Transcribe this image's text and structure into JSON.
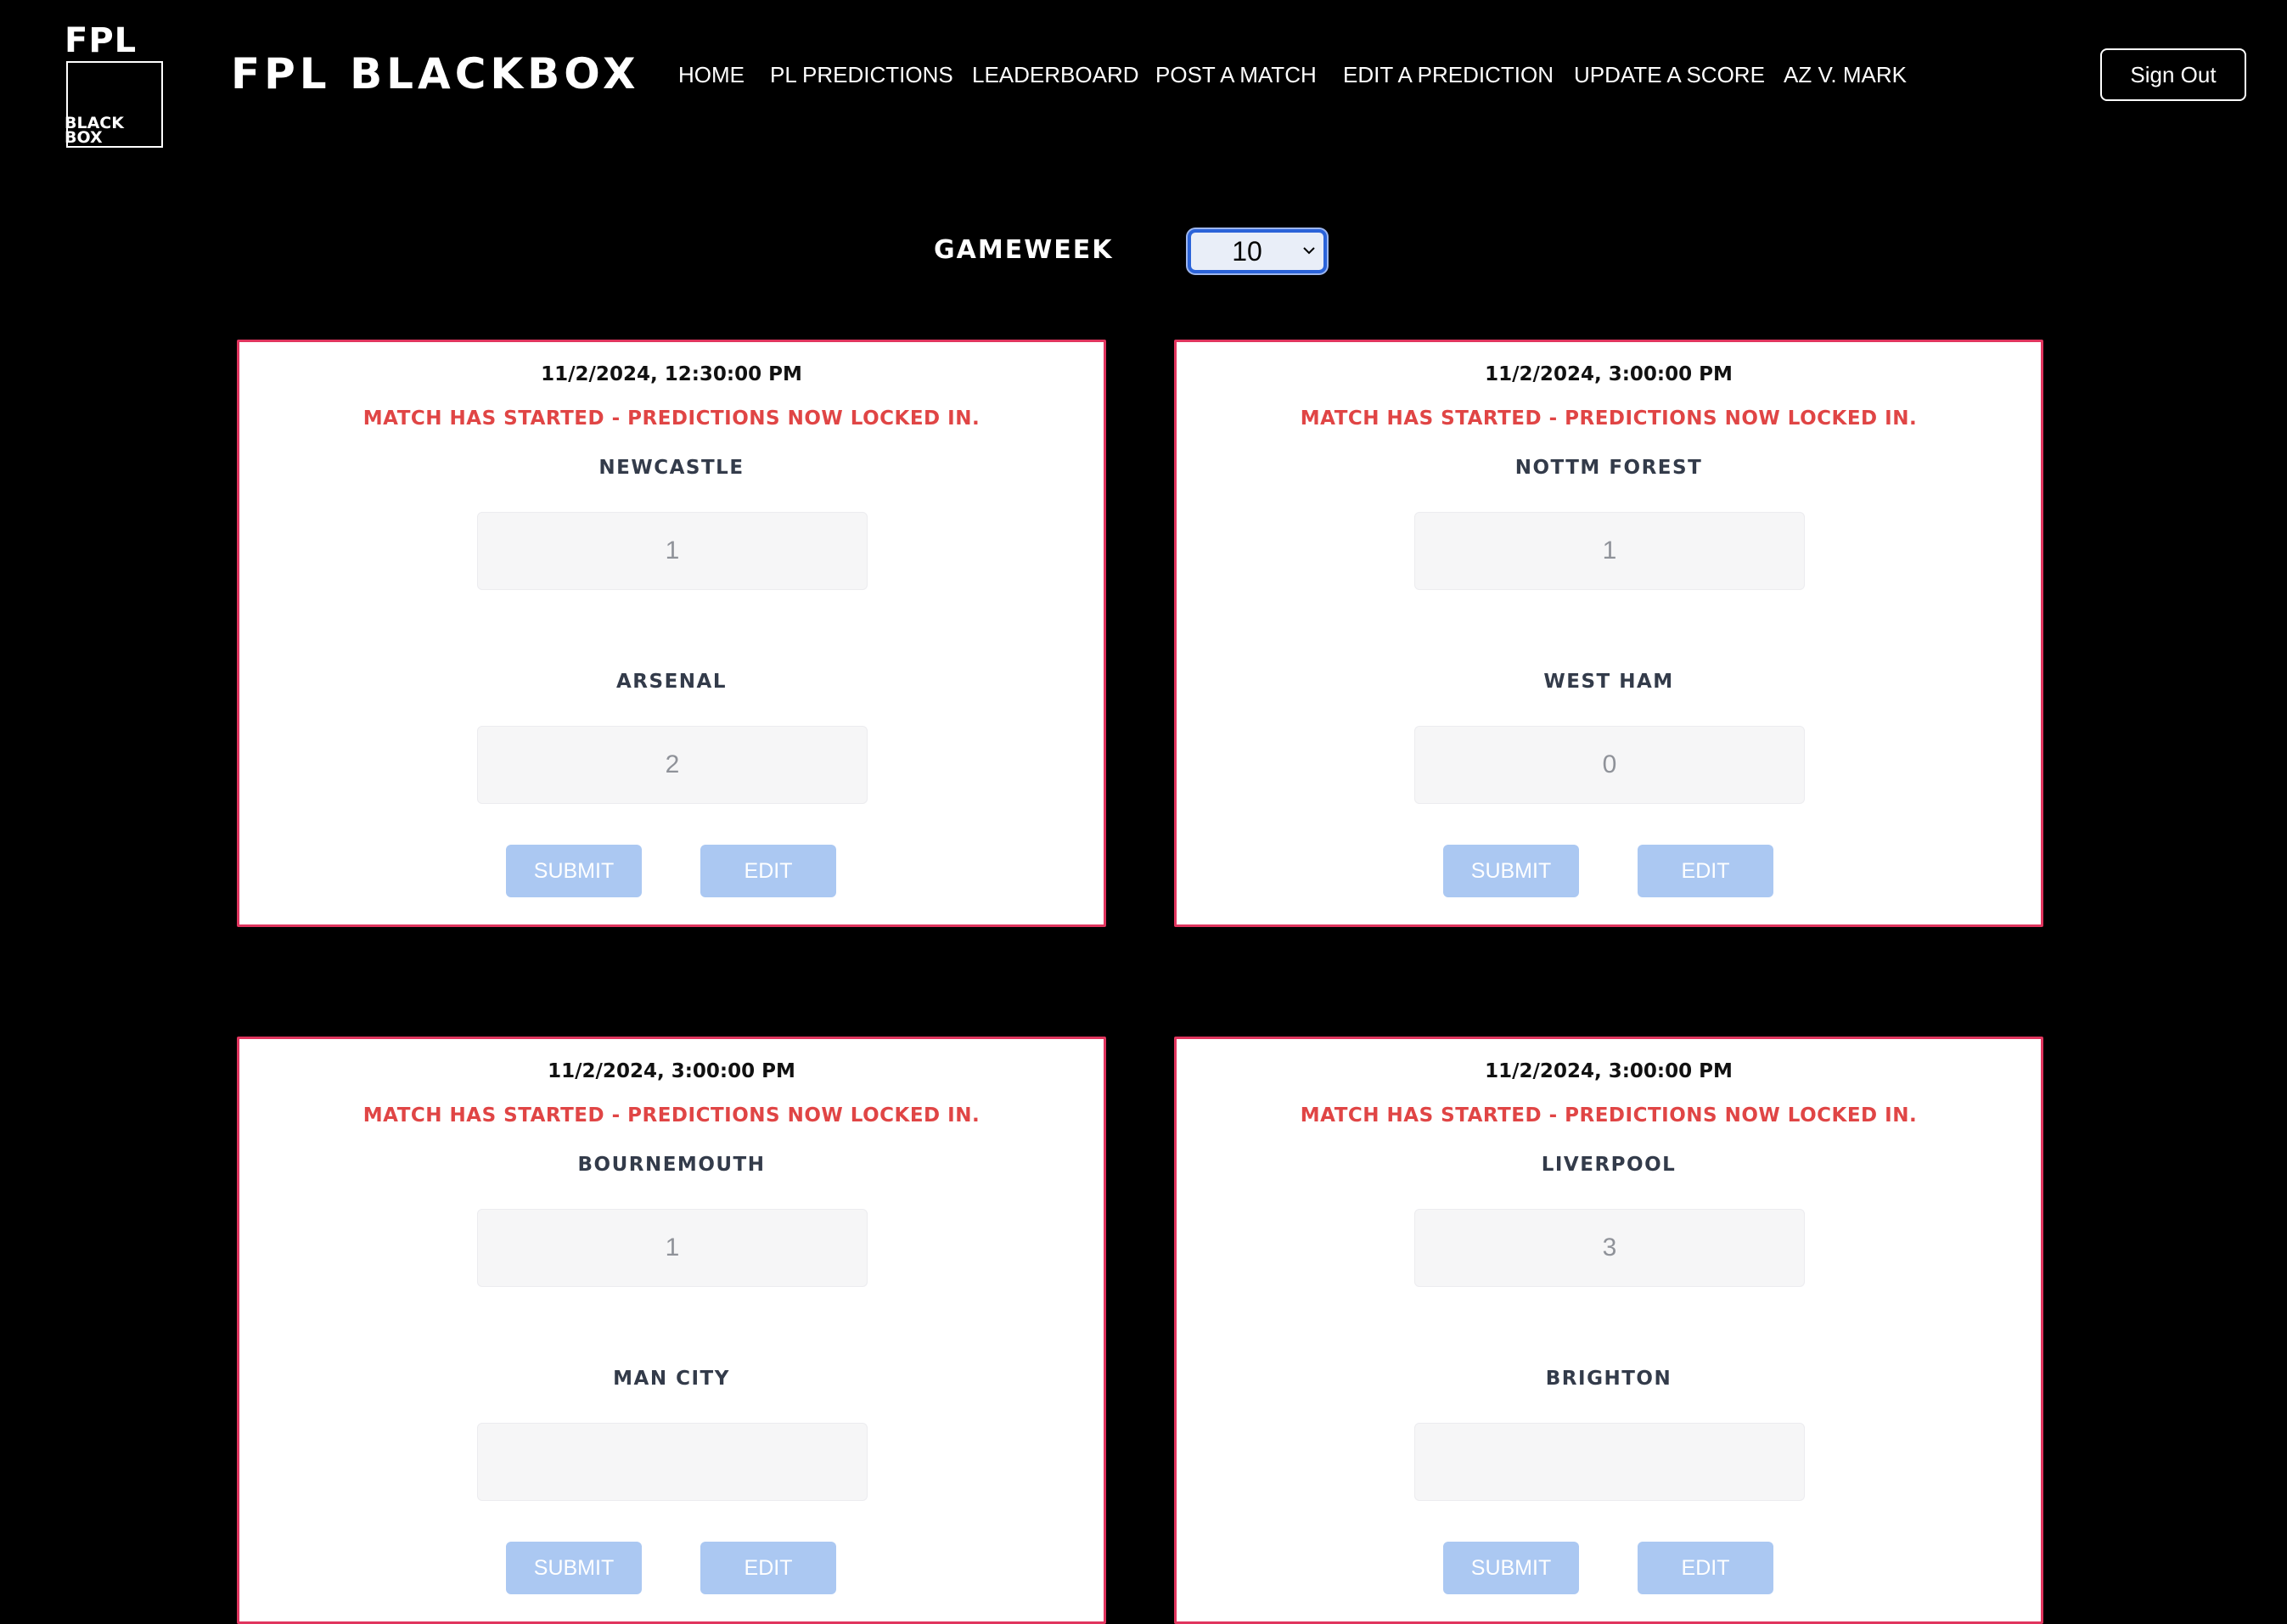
{
  "logo": {
    "top_text": "FPL",
    "box_line1": "BLACK",
    "box_line2": "BOX"
  },
  "brand": {
    "title": "FPL BLACKBOX"
  },
  "nav": {
    "items": [
      {
        "label": "HOME"
      },
      {
        "label": "PL PREDICTIONS"
      },
      {
        "label": "LEADERBOARD"
      },
      {
        "label": "POST A MATCH"
      },
      {
        "label": "EDIT A PREDICTION"
      },
      {
        "label": "UPDATE A SCORE"
      },
      {
        "label": "AZ V. MARK"
      }
    ]
  },
  "auth": {
    "sign_out_label": "Sign Out"
  },
  "gameweek": {
    "label": "GAMEWEEK",
    "selected": "10"
  },
  "matches": [
    {
      "datetime": "11/2/2024, 12:30:00 PM",
      "status": "MATCH HAS STARTED - PREDICTIONS NOW LOCKED IN.",
      "home_team": "NEWCASTLE",
      "home_score": "1",
      "away_team": "ARSENAL",
      "away_score": "2",
      "submit_label": "SUBMIT",
      "edit_label": "EDIT"
    },
    {
      "datetime": "11/2/2024, 3:00:00 PM",
      "status": "MATCH HAS STARTED - PREDICTIONS NOW LOCKED IN.",
      "home_team": "NOTTM FOREST",
      "home_score": "1",
      "away_team": "WEST HAM",
      "away_score": "0",
      "submit_label": "SUBMIT",
      "edit_label": "EDIT"
    },
    {
      "datetime": "11/2/2024, 3:00:00 PM",
      "status": "MATCH HAS STARTED - PREDICTIONS NOW LOCKED IN.",
      "home_team": "BOURNEMOUTH",
      "home_score": "1",
      "away_team": "MAN CITY",
      "away_score": "",
      "submit_label": "SUBMIT",
      "edit_label": "EDIT"
    },
    {
      "datetime": "11/2/2024, 3:00:00 PM",
      "status": "MATCH HAS STARTED - PREDICTIONS NOW LOCKED IN.",
      "home_team": "LIVERPOOL",
      "home_score": "3",
      "away_team": "BRIGHTON",
      "away_score": "",
      "submit_label": "SUBMIT",
      "edit_label": "EDIT"
    }
  ],
  "colors": {
    "background": "#000000",
    "card_border": "#e0355e",
    "locked_text": "#e04545",
    "disabled_button": "#abc8f2",
    "select_focus": "#2b63d9"
  }
}
